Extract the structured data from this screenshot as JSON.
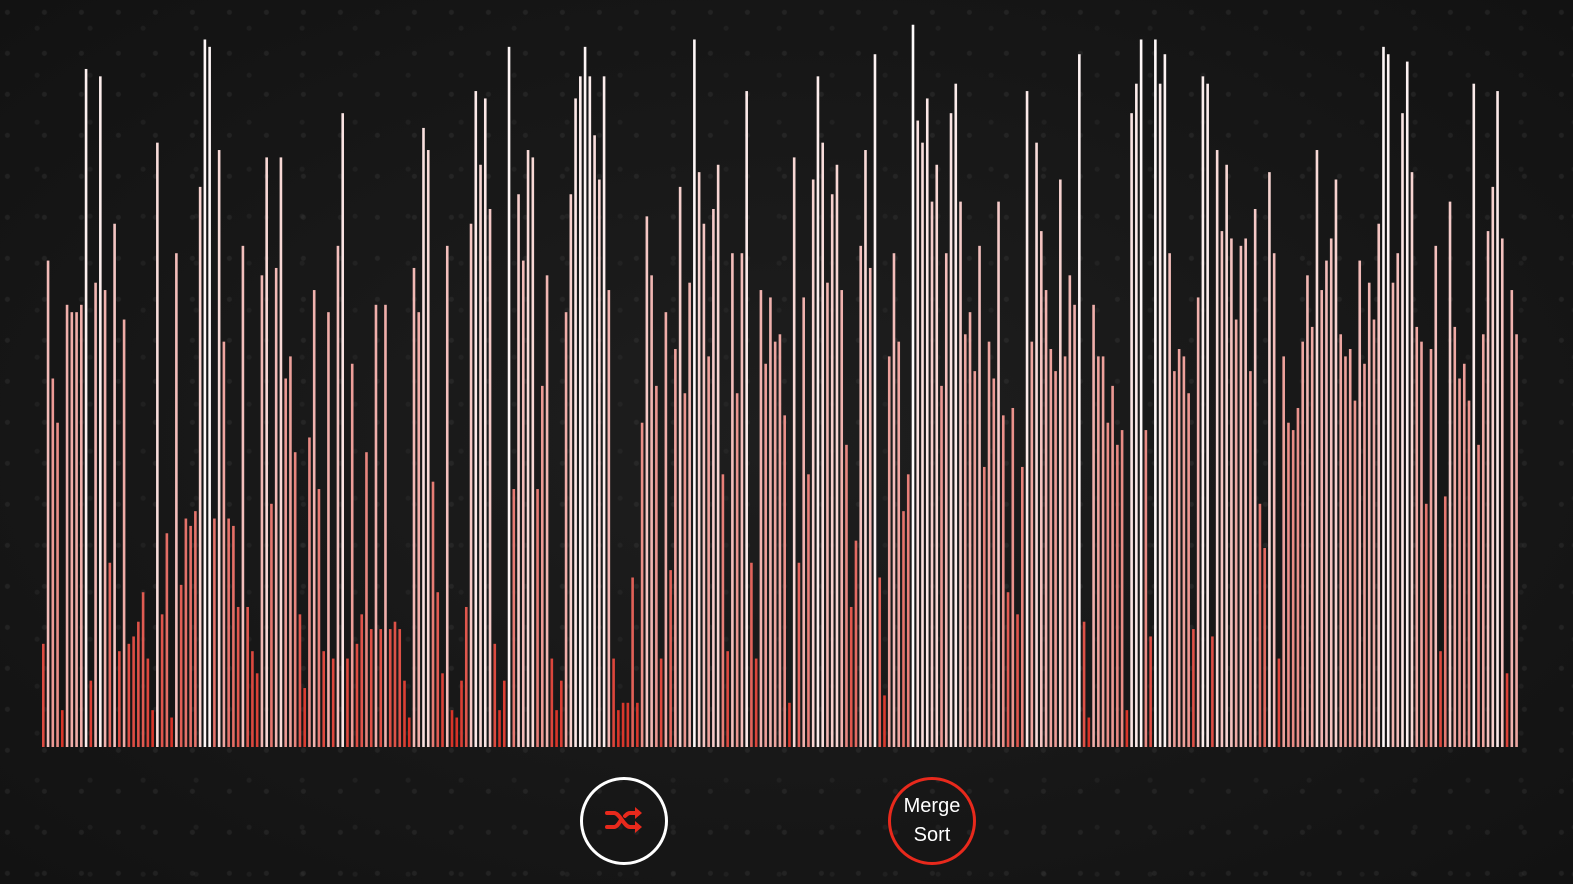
{
  "colors": {
    "background": "#161616",
    "bar_low": "#d6261a",
    "bar_high": "#ffffff",
    "shuffle_border": "#ffffff",
    "shuffle_icon": "#e8291c",
    "sort_border": "#e8291c"
  },
  "controls": {
    "shuffle": {
      "icon": "shuffle-icon"
    },
    "sort": {
      "label_line1": "Merge",
      "label_line2": "Sort"
    }
  },
  "chart_data": {
    "type": "bar",
    "max_value": 100,
    "values": [
      14,
      66,
      50,
      44,
      5,
      60,
      59,
      59,
      60,
      92,
      9,
      63,
      91,
      62,
      25,
      71,
      13,
      58,
      14,
      15,
      17,
      21,
      12,
      5,
      82,
      18,
      29,
      4,
      67,
      22,
      31,
      30,
      32,
      76,
      96,
      95,
      31,
      81,
      55,
      31,
      30,
      19,
      68,
      19,
      13,
      10,
      64,
      80,
      33,
      65,
      80,
      50,
      53,
      40,
      18,
      8,
      42,
      62,
      35,
      13,
      59,
      12,
      68,
      86,
      12,
      52,
      14,
      18,
      40,
      16,
      60,
      16,
      60,
      16,
      17,
      16,
      9,
      4,
      65,
      59,
      84,
      81,
      36,
      21,
      10,
      68,
      5,
      4,
      9,
      19,
      71,
      89,
      79,
      88,
      73,
      14,
      5,
      9,
      95,
      35,
      75,
      66,
      81,
      80,
      35,
      49,
      64,
      12,
      5,
      9,
      59,
      75,
      88,
      91,
      95,
      91,
      83,
      77,
      91,
      62,
      12,
      5,
      6,
      6,
      23,
      6,
      44,
      72,
      64,
      49,
      12,
      59,
      24,
      54,
      76,
      48,
      63,
      96,
      78,
      71,
      53,
      73,
      79,
      37,
      13,
      67,
      48,
      67,
      89,
      25,
      12,
      62,
      52,
      61,
      55,
      56,
      45,
      6,
      80,
      25,
      61,
      37,
      77,
      91,
      82,
      63,
      75,
      79,
      62,
      41,
      19,
      28,
      68,
      81,
      65,
      94,
      23,
      7,
      53,
      67,
      55,
      32,
      37,
      98,
      85,
      82,
      88,
      74,
      79,
      49,
      67,
      86,
      90,
      74,
      56,
      59,
      51,
      68,
      38,
      55,
      50,
      74,
      45,
      21,
      46,
      18,
      38,
      89,
      55,
      82,
      70,
      62,
      54,
      51,
      77,
      53,
      64,
      60,
      94,
      17,
      4,
      60,
      53,
      53,
      44,
      49,
      41,
      43,
      5,
      86,
      90,
      96,
      43,
      15,
      96,
      90,
      94,
      67,
      51,
      54,
      53,
      48,
      16,
      61,
      91,
      90,
      15,
      81,
      70,
      79,
      69,
      58,
      68,
      69,
      51,
      73,
      33,
      27,
      78,
      67,
      12,
      53,
      44,
      43,
      46,
      55,
      64,
      57,
      81,
      62,
      66,
      69,
      77,
      56,
      53,
      54,
      47,
      66,
      52,
      63,
      58,
      71,
      95,
      94,
      63,
      67,
      86,
      93,
      78,
      57,
      55,
      33,
      54,
      68,
      13,
      34,
      74,
      57,
      50,
      52,
      47,
      90,
      41,
      56,
      70,
      76,
      89,
      69,
      10,
      62,
      56
    ]
  }
}
